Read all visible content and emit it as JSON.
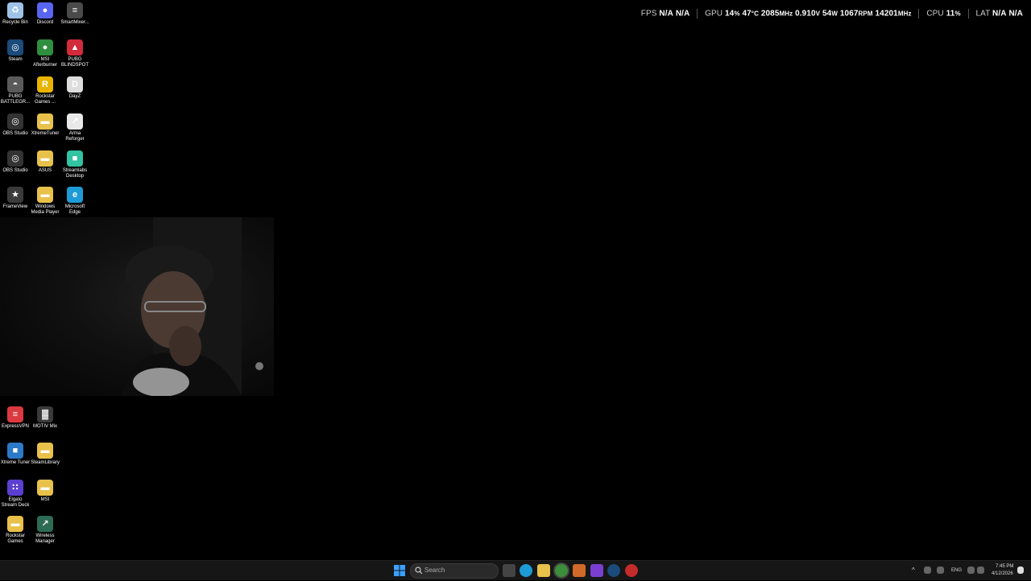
{
  "desktop_icons": [
    {
      "label": "Recycle Bin",
      "color": "#9fc3e8",
      "glyph": "♻"
    },
    {
      "label": "Discord",
      "color": "#5865F2",
      "glyph": "●"
    },
    {
      "label": "SmartMixer...",
      "color": "#4a4a4a",
      "glyph": "≡"
    },
    {
      "label": "Steam",
      "color": "#1b4b7a",
      "glyph": "◎"
    },
    {
      "label": "MSI Afterburner",
      "color": "#2f8f3f",
      "glyph": "●"
    },
    {
      "label": "PUBG BLINDSPOT",
      "color": "#d22b3b",
      "glyph": "▲"
    },
    {
      "label": "PUBG BATTLEGR...",
      "color": "#5a5a5a",
      "glyph": "◓"
    },
    {
      "label": "Rockstar Games ...",
      "color": "#e8b400",
      "glyph": "R"
    },
    {
      "label": "DayZ",
      "color": "#dddddd",
      "glyph": "D"
    },
    {
      "label": "OBS Studio",
      "color": "#333333",
      "glyph": "◎"
    },
    {
      "label": "XtremeTuner",
      "color": "#e8c14a",
      "glyph": "▬"
    },
    {
      "label": "Arma Reforger",
      "color": "#e8e8e8",
      "glyph": "↗"
    },
    {
      "label": "OBS Studio",
      "color": "#333333",
      "glyph": "◎"
    },
    {
      "label": "ASUS",
      "color": "#e8c14a",
      "glyph": "▬"
    },
    {
      "label": "Streamlabs Desktop",
      "color": "#31c3a2",
      "glyph": "■"
    },
    {
      "label": "FrameView",
      "color": "#3a3a3a",
      "glyph": "★"
    },
    {
      "label": "Windows Media Player",
      "color": "#e8c14a",
      "glyph": "▬"
    },
    {
      "label": "Microsoft Edge",
      "color": "#1d9bd6",
      "glyph": "e"
    },
    {
      "label": "ExpressVPN",
      "color": "#da3940",
      "glyph": "≡"
    },
    {
      "label": "MOTIV Mix",
      "color": "#3a3a3a",
      "glyph": "▓"
    },
    {
      "label": "Xtreme Tuner",
      "color": "#2c79c7",
      "glyph": "■"
    },
    {
      "label": "SteamLibrary",
      "color": "#e8c14a",
      "glyph": "▬"
    },
    {
      "label": "Elgato Stream Deck",
      "color": "#5b3fd1",
      "glyph": "∷"
    },
    {
      "label": "MSI",
      "color": "#e8c14a",
      "glyph": "▬"
    },
    {
      "label": "Rockstar Games",
      "color": "#e8c14a",
      "glyph": "▬"
    },
    {
      "label": "Wireless Manager",
      "color": "#2e6b55",
      "glyph": "↗"
    }
  ],
  "osd": {
    "fps_label": "FPS",
    "fps_1": "N/A",
    "fps_2": "N/A",
    "gpu_label": "GPU",
    "gpu_load": "14",
    "gpu_load_unit": "%",
    "gpu_temp": "47",
    "gpu_temp_unit": "°C",
    "gpu_clock": "2085",
    "gpu_clock_unit": "MHz",
    "gpu_volt": "0.910",
    "gpu_volt_unit": "V",
    "gpu_power": "54",
    "gpu_power_unit": "W",
    "fan": "1067",
    "fan_unit": "RPM",
    "mem_clock": "14201",
    "mem_clock_unit": "MHz",
    "cpu_label": "CPU",
    "cpu_load": "11",
    "cpu_load_unit": "%",
    "lat_label": "LAT",
    "lat_1": "N/A",
    "lat_2": "N/A"
  },
  "taskbar": {
    "search_placeholder": "Search",
    "tray_lang": "ENG",
    "time": "7:45 PM",
    "date": "4/12/2026"
  }
}
